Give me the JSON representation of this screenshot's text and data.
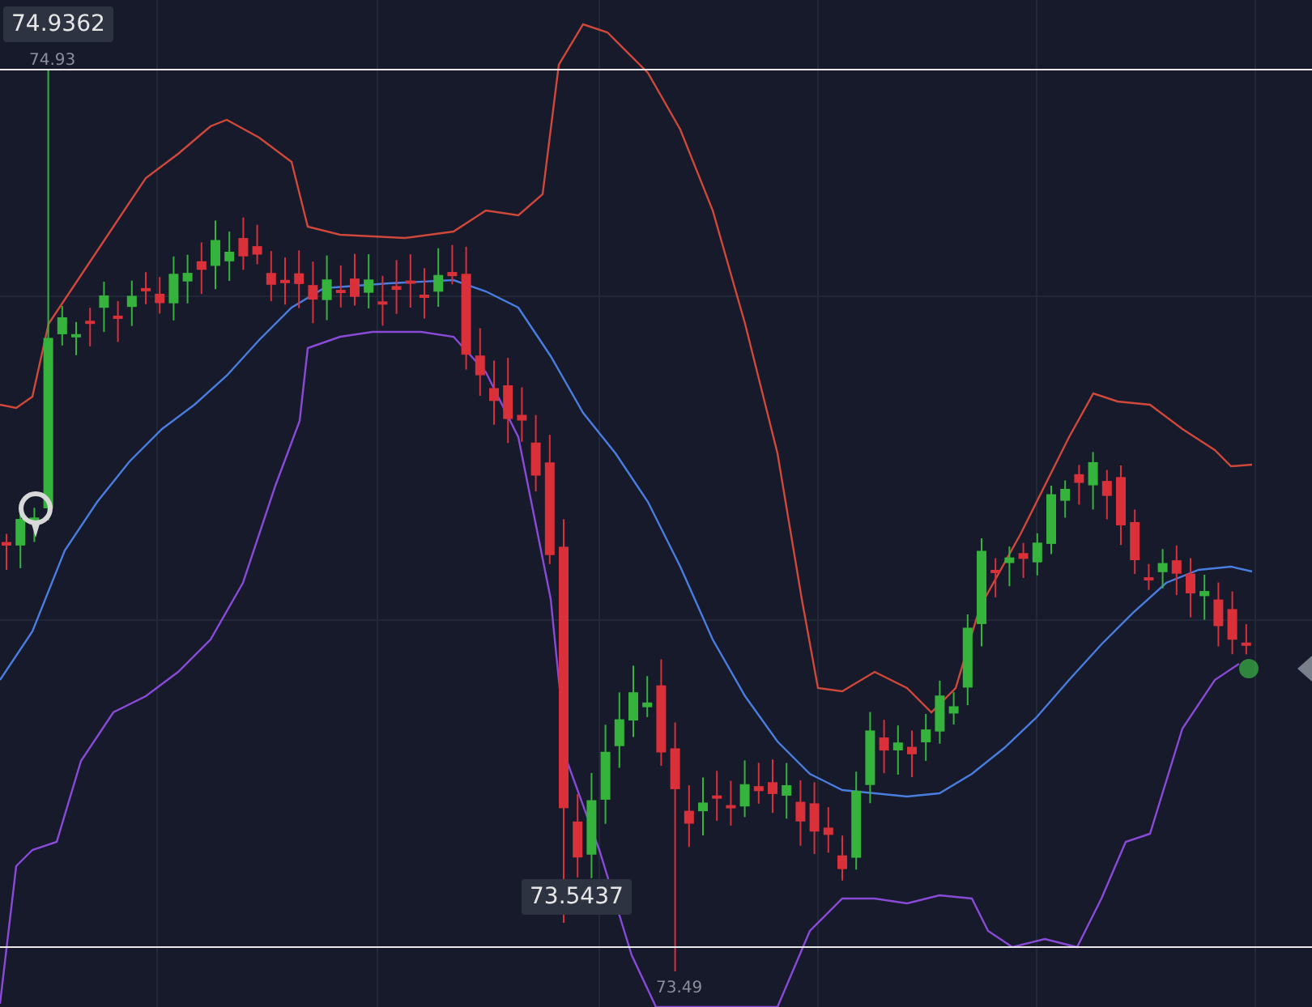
{
  "chart": {
    "high_price_tag": "74.9362",
    "high_line_label": "74.93",
    "low_price_tag": "73.5437",
    "low_line_label": "73.49"
  }
}
